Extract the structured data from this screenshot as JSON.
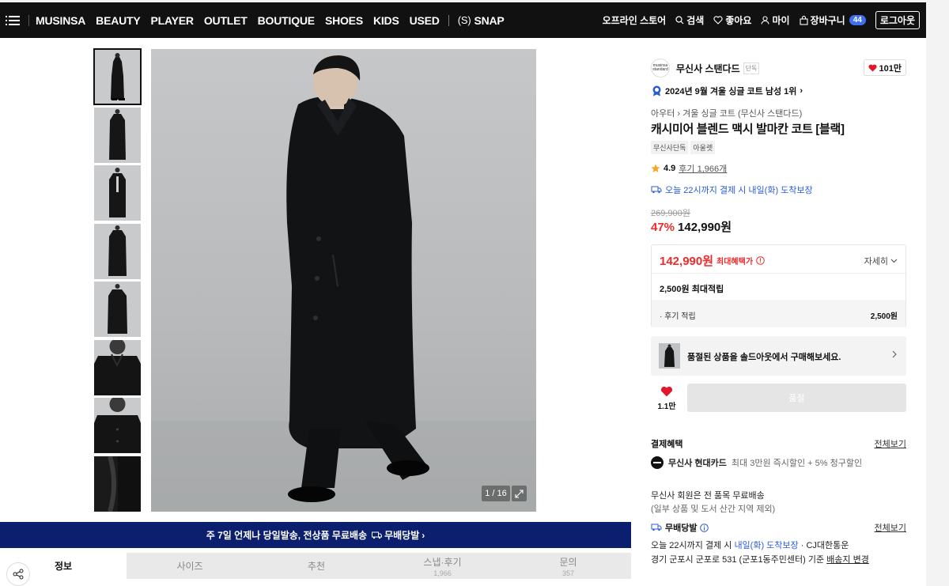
{
  "nav": {
    "items": [
      "MUSINSA",
      "BEAUTY",
      "PLAYER",
      "OUTLET",
      "BOUTIQUE",
      "SHOES",
      "KIDS",
      "USED"
    ],
    "snap_bracket": "(S)",
    "snap_label": "SNAP",
    "offline_store": "오프라인 스토어",
    "search": "검색",
    "likes": "좋아요",
    "my": "마이",
    "cart": "장바구니",
    "cart_count": "44",
    "logout": "로그아웃"
  },
  "gallery": {
    "counter": "1 / 16"
  },
  "banner": {
    "text": "주 7일 언제나 당일발송, 전상품 무료배송",
    "badge": "무배당발"
  },
  "tabs": [
    {
      "label": "정보",
      "count": ""
    },
    {
      "label": "사이즈",
      "count": ""
    },
    {
      "label": "추천",
      "count": ""
    },
    {
      "label": "스냅·후기",
      "count": "1,966"
    },
    {
      "label": "문의",
      "count": "357"
    }
  ],
  "product": {
    "brand_logo": "musinsa standard",
    "brand": "무신사 스탠다드",
    "brand_tag": "단독",
    "likes": "101만",
    "rank": "2024년 9월 겨울 싱글 코트 남성 1위",
    "breadcrumb": "아우터 › 겨울 싱글 코트 (무신사 스탠다드)",
    "title": "캐시미어 블렌드 맥시 발마칸 코트 [블랙]",
    "chips": [
      "무신사단독",
      "아울렛"
    ],
    "rating": "4.9",
    "reviews": "후기 1,966개",
    "delivery": "오늘 22시까지 결제 시 내일(화) 도착보장",
    "original_price": "269,900원",
    "discount": "47%",
    "price": "142,990원"
  },
  "benefit": {
    "price": "142,990원",
    "max_label": "최대혜택가",
    "detail": "자세히",
    "points": "2,500원 최대적립",
    "review_label": "· 후기 적립",
    "review_value": "2,500원"
  },
  "soldout": {
    "text": "품절된 상품을 솔드아웃에서 구매해보세요."
  },
  "buy": {
    "like_count": "1.1만",
    "button": "품절"
  },
  "payment": {
    "title": "결제혜택",
    "more": "전체보기",
    "card_name": "무신사 현대카드",
    "card_desc": "최대 3만원 즉시할인 + 5% 청구할인"
  },
  "shipping": {
    "member_line1": "무신사 회원은 전 품목 무료배송",
    "member_line2": "(일부 상품 및 도서 산간 지역 제외)",
    "free_ship_label": "무배당발",
    "more": "전체보기",
    "line1_pre": "오늘 22시까지 결제 시",
    "line1_blue": "내일(화) 도착보장",
    "line1_post": "· CJ대한통운",
    "line2_pre": "경기 군포시 군포로 531 (군포1동주민센터) 기준",
    "line2_link": "배송지 변경"
  }
}
